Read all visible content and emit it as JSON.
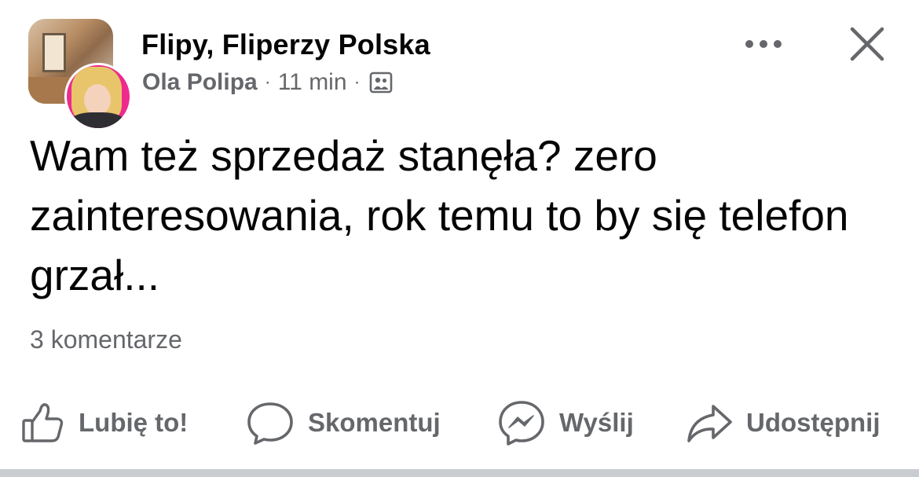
{
  "header": {
    "group_name": "Flipy, Fliperzy Polska",
    "author": "Ola Polipa",
    "separator": "·",
    "time": "11 min",
    "audience_icon": "group-members-icon",
    "more_icon": "more-dots-icon",
    "close_icon": "close-icon"
  },
  "post": {
    "text": "Wam też sprzedaż stanęła? zero zainteresowania, rok temu to by się telefon grzał...",
    "comments_count": "3 komentarze"
  },
  "actions": [
    {
      "label": "Lubię to!",
      "icon": "like-thumb-icon"
    },
    {
      "label": "Skomentuj",
      "icon": "comment-bubble-icon"
    },
    {
      "label": "Wyślij",
      "icon": "messenger-icon"
    },
    {
      "label": "Udostępnij",
      "icon": "share-arrow-icon"
    }
  ],
  "colors": {
    "primary_text": "#050505",
    "secondary_text": "#65676b",
    "background": "#ffffff",
    "divider": "#c9ccd1"
  }
}
